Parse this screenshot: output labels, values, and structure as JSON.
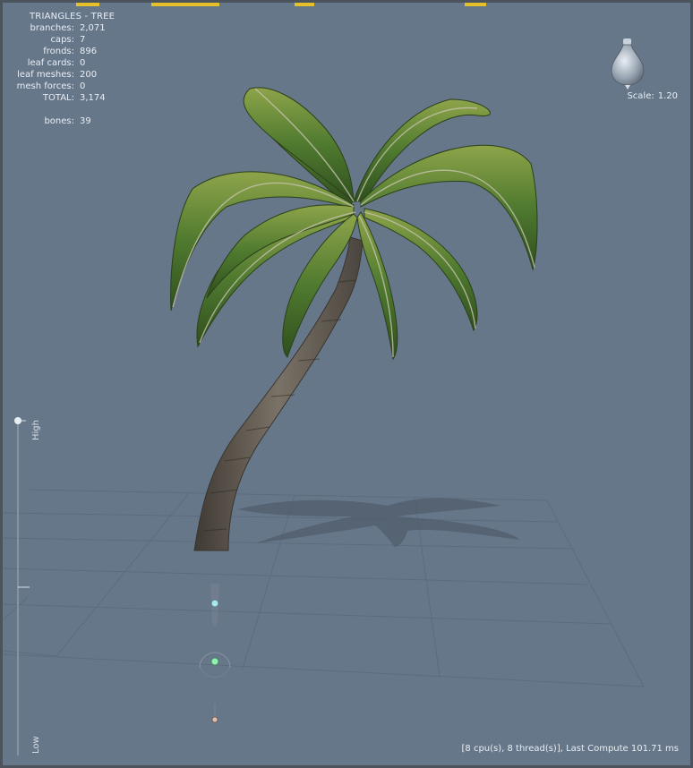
{
  "stats": {
    "title": "TRIANGLES - TREE",
    "rows": [
      {
        "label": "branches:",
        "value": "2,071"
      },
      {
        "label": "caps:",
        "value": "7"
      },
      {
        "label": "fronds:",
        "value": "896"
      },
      {
        "label": "leaf cards:",
        "value": "0"
      },
      {
        "label": "leaf meshes:",
        "value": "200"
      },
      {
        "label": "mesh forces:",
        "value": "0"
      },
      {
        "label": "TOTAL:",
        "value": "3,174"
      }
    ],
    "bones_label": "bones:",
    "bones_value": "39"
  },
  "scale": {
    "label": "Scale:",
    "value": "1.20"
  },
  "lod_slider": {
    "high_label": "High",
    "low_label": "Low",
    "level": 1.0
  },
  "status_text": "[8 cpu(s), 8 thread(s)], Last Compute 101.71 ms",
  "colors": {
    "background": "#67778a",
    "accent_tab": "#e4c12a",
    "grid": "#58697b",
    "frond_green": "#4e7a2e",
    "trunk": "#5a5045"
  },
  "icons": {
    "light_gizmo": "light-bulb-icon",
    "wind_handle": "wind-handle-icon",
    "tree_handle": "tree-handle-icon",
    "root_handle": "root-handle-icon"
  }
}
